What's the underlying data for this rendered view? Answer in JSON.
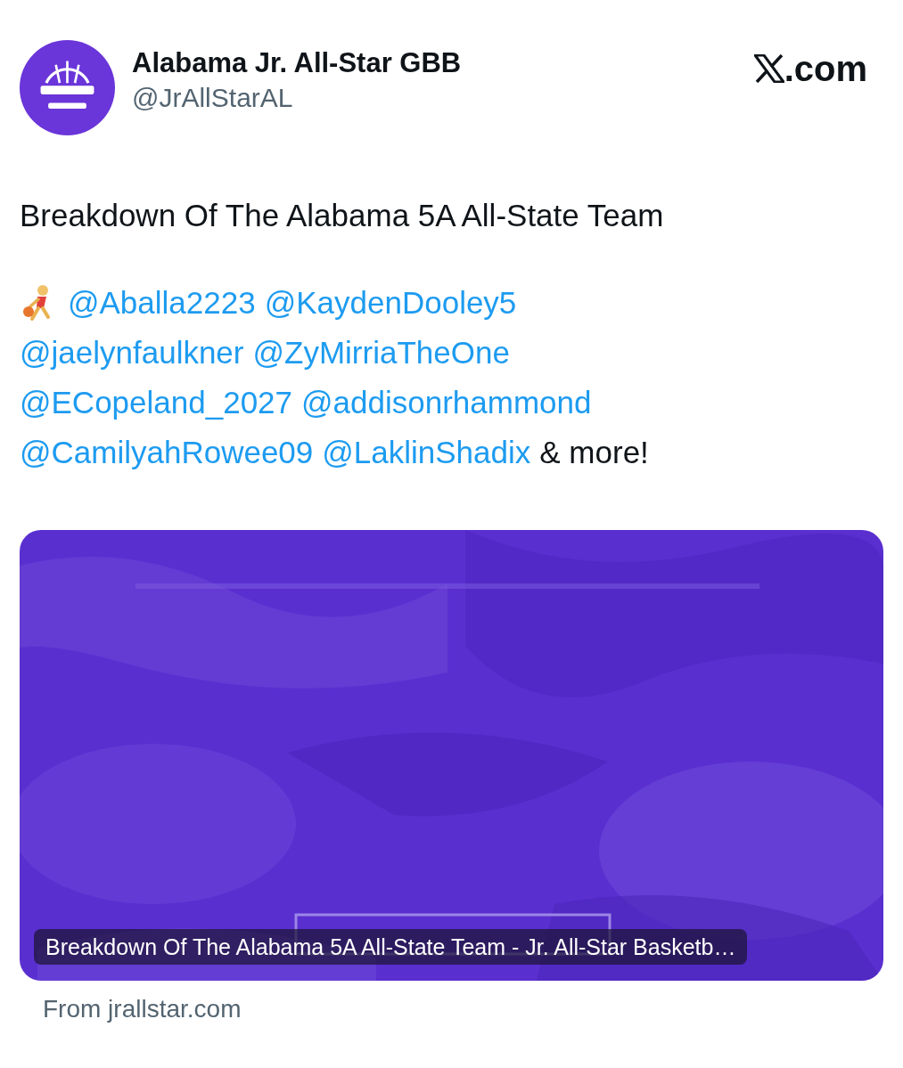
{
  "account": {
    "name": "Alabama Jr. All-Star GBB",
    "handle": "@JrAllStarAL"
  },
  "source": {
    "label": ".com"
  },
  "post": {
    "headline": "Breakdown Of The Alabama 5A All-State Team",
    "lines": [
      [
        {
          "kind": "emoji"
        },
        {
          "kind": "mention",
          "text": "@Aballa2223"
        },
        {
          "kind": "mention",
          "text": "@KaydenDooley5"
        }
      ],
      [
        {
          "kind": "mention",
          "text": "@jaelynfaulkner"
        },
        {
          "kind": "mention",
          "text": "@ZyMirriaTheOne"
        }
      ],
      [
        {
          "kind": "mention",
          "text": "@ECopeland_2027"
        },
        {
          "kind": "mention",
          "text": "@addisonrhammond"
        }
      ],
      [
        {
          "kind": "mention",
          "text": "@CamilyahRowee09"
        },
        {
          "kind": "mention",
          "text": "@LaklinShadix"
        },
        {
          "kind": "text",
          "text": "& more!"
        }
      ]
    ]
  },
  "link_card": {
    "caption": "Breakdown Of The Alabama 5A All-State Team - Jr. All-Star Basketb…",
    "source": "From jrallstar.com"
  }
}
